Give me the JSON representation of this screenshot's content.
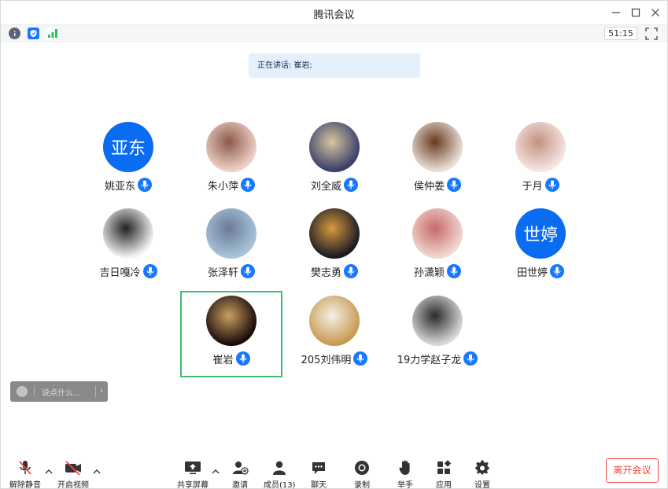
{
  "window": {
    "title": "腾讯会议"
  },
  "status": {
    "timer": "51:15"
  },
  "banner": {
    "speaking_text": "正在讲话: 崔岩;"
  },
  "participants": [
    {
      "name": "姚亚东",
      "avatar_text": "亚东",
      "avatar_kind": "text"
    },
    {
      "name": "朱小萍",
      "avatar_kind": "photo",
      "colors": [
        "#f0d0c8",
        "#8a5a4a"
      ]
    },
    {
      "name": "刘全威",
      "avatar_kind": "photo",
      "colors": [
        "#3a3f6a",
        "#d8c6a0"
      ]
    },
    {
      "name": "侯仲姜",
      "avatar_kind": "photo",
      "colors": [
        "#e8e0d8",
        "#6a3a20"
      ]
    },
    {
      "name": "于月",
      "avatar_kind": "photo",
      "colors": [
        "#f4e6e2",
        "#c49080"
      ]
    },
    {
      "name": "吉日嘎冷",
      "avatar_kind": "photo",
      "colors": [
        "#f2f2f2",
        "#222222"
      ]
    },
    {
      "name": "张泽轩",
      "avatar_kind": "photo",
      "colors": [
        "#a8c4d8",
        "#6a7a9a"
      ]
    },
    {
      "name": "樊志勇",
      "avatar_kind": "photo",
      "colors": [
        "#1a1a24",
        "#d89a40"
      ]
    },
    {
      "name": "孙潇颖",
      "avatar_kind": "photo",
      "colors": [
        "#f0d8d0",
        "#c86a6a"
      ]
    },
    {
      "name": "田世婷",
      "avatar_text": "世婷",
      "avatar_kind": "text"
    },
    {
      "name": "崔岩",
      "avatar_kind": "photo",
      "colors": [
        "#1a0a0a",
        "#c8a060"
      ],
      "highlighted": true
    },
    {
      "name": "205刘伟明",
      "avatar_kind": "photo",
      "colors": [
        "#c89a50",
        "#f4f0e8"
      ]
    },
    {
      "name": "19力学赵子龙",
      "avatar_kind": "photo",
      "colors": [
        "#d8d8d8",
        "#2a2a2a"
      ]
    }
  ],
  "chat": {
    "placeholder": "说点什么..."
  },
  "toolbar": {
    "unmute": "解除静音",
    "start_video": "开启视频",
    "share_screen": "共享屏幕",
    "invite": "邀请",
    "members": "成员(13)",
    "chat": "聊天",
    "record": "录制",
    "raise_hand": "举手",
    "apps": "应用",
    "settings": "设置",
    "leave": "离开会议"
  },
  "colors": {
    "accent": "#1677ff",
    "speaker_border": "#3cbf6e",
    "leave": "#f0483e"
  }
}
